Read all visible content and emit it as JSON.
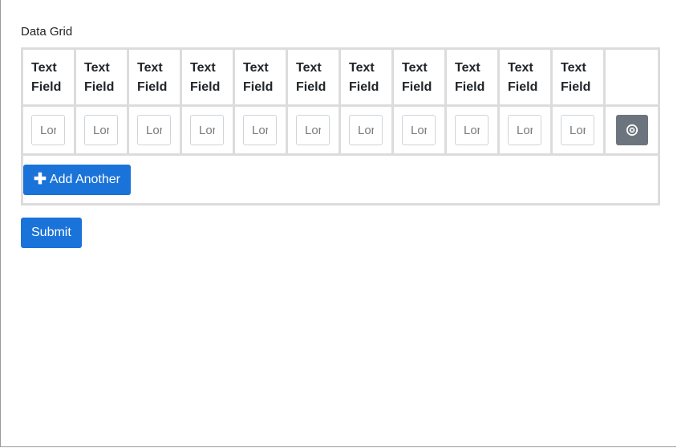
{
  "form": {
    "grid_label": "Data Grid",
    "columns": [
      {
        "label": "Text Field"
      },
      {
        "label": "Text Field"
      },
      {
        "label": "Text Field"
      },
      {
        "label": "Text Field"
      },
      {
        "label": "Text Field"
      },
      {
        "label": "Text Field"
      },
      {
        "label": "Text Field"
      },
      {
        "label": "Text Field"
      },
      {
        "label": "Text Field"
      },
      {
        "label": "Text Field"
      },
      {
        "label": "Text Field"
      }
    ],
    "rows": [
      {
        "cells": [
          {
            "value": "",
            "placeholder": "Lorem"
          },
          {
            "value": "",
            "placeholder": "Lorem"
          },
          {
            "value": "",
            "placeholder": "Lorem"
          },
          {
            "value": "",
            "placeholder": "Lorem"
          },
          {
            "value": "",
            "placeholder": "Lorem"
          },
          {
            "value": "",
            "placeholder": "Lorem"
          },
          {
            "value": "",
            "placeholder": "Lorem"
          },
          {
            "value": "",
            "placeholder": "Lorem"
          },
          {
            "value": "",
            "placeholder": "Lorem"
          },
          {
            "value": "",
            "placeholder": "Lorem"
          },
          {
            "value": "",
            "placeholder": "Lorem"
          }
        ],
        "remove_icon": "remove-circle-icon"
      }
    ],
    "add_button": {
      "label": "Add Another",
      "icon": "plus-icon"
    },
    "submit_label": "Submit"
  },
  "colors": {
    "primary": "#1a73d9",
    "secondary": "#6c757d",
    "grid_border": "#dcdcdc"
  }
}
